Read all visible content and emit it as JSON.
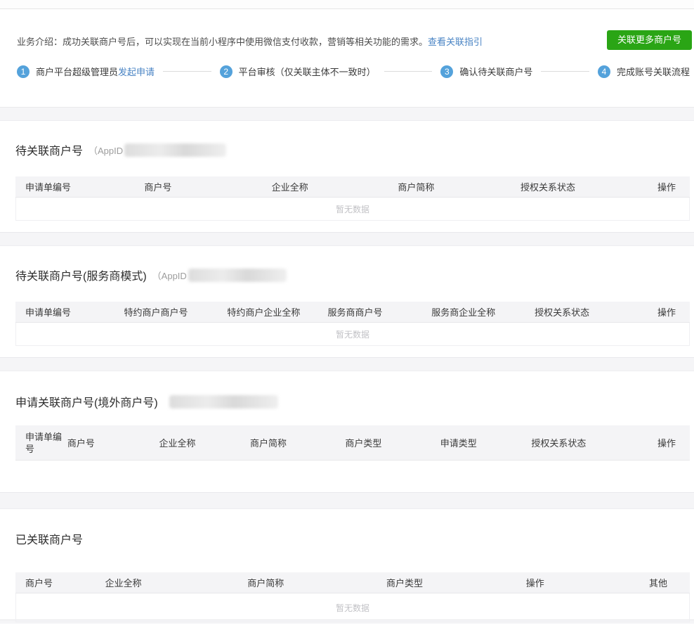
{
  "intro": {
    "text": "业务介绍：成功关联商户号后，可以实现在当前小程序中使用微信支付收款，营销等相关功能的需求。",
    "link": "查看关联指引",
    "button": "关联更多商户号"
  },
  "steps": [
    {
      "num": "1",
      "text": "商户平台超级管理员",
      "link": "发起申请"
    },
    {
      "num": "2",
      "text": "平台审核（仅关联主体不一致时）",
      "link": ""
    },
    {
      "num": "3",
      "text": "确认待关联商户号",
      "link": ""
    },
    {
      "num": "4",
      "text": "完成账号关联流程",
      "link": ""
    }
  ],
  "sections": [
    {
      "title": "待关联商户号",
      "subtitle_prefix": "（AppID",
      "columns": [
        "申请单编号",
        "商户号",
        "企业全称",
        "商户简称",
        "授权关系状态",
        "操作"
      ],
      "empty": "暂无数据"
    },
    {
      "title": "待关联商户号(服务商模式)",
      "subtitle_prefix": "（AppID",
      "columns": [
        "申请单编号",
        "特约商户商户号",
        "特约商户企业全称",
        "服务商商户号",
        "服务商企业全称",
        "授权关系状态",
        "操作"
      ],
      "empty": "暂无数据"
    },
    {
      "title": "申请关联商户号(境外商户号)",
      "subtitle_prefix": "",
      "columns": [
        "申请单编号",
        "商户号",
        "企业全称",
        "商户简称",
        "商户类型",
        "申请类型",
        "授权关系状态",
        "操作"
      ],
      "empty": ""
    },
    {
      "title": "已关联商户号",
      "subtitle_prefix": "",
      "columns": [
        "商户号",
        "企业全称",
        "商户简称",
        "商户类型",
        "操作",
        "其他"
      ],
      "empty": "暂无数据"
    }
  ],
  "colors": {
    "accent_green": "#2aa515",
    "step_circle_blue": "#54a2db",
    "link_blue": "#4a84c4",
    "divider_band": "#f5f5f7",
    "table_header_bg": "#f4f4f6",
    "empty_text": "#c2c2c6"
  }
}
